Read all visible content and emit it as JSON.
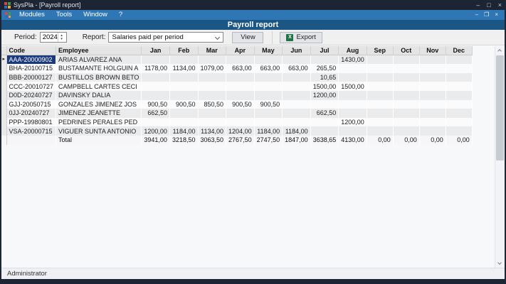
{
  "window": {
    "title": "SysPla - [Payroll report]",
    "controls": {
      "minimize": "–",
      "maximize": "□",
      "close": "×"
    }
  },
  "menu": {
    "items": [
      "Modules",
      "Tools",
      "Window",
      "?"
    ],
    "child_controls": {
      "minimize": "–",
      "restore": "❐",
      "close": "×"
    }
  },
  "header": {
    "title": "Payroll report"
  },
  "toolbar": {
    "period_label": "Period:",
    "period_value": "2024",
    "report_label": "Report:",
    "report_value": "Salaries paid per period",
    "view_label": "View",
    "export_label": "Export",
    "export_icon": "excel-icon",
    "export_icon_letter": "X"
  },
  "grid": {
    "columns": [
      "Code",
      "Employee",
      "Jan",
      "Feb",
      "Mar",
      "Apr",
      "May",
      "Jun",
      "Jul",
      "Aug",
      "Sep",
      "Oct",
      "Nov",
      "Dec"
    ],
    "rows": [
      {
        "code": "AAA-20000902",
        "employee": "ARIAS ALVAREZ ANA",
        "selected": true,
        "values": [
          "",
          "",
          "",
          "",
          "",
          "",
          "",
          "1430,00",
          "",
          "",
          "",
          ""
        ]
      },
      {
        "code": "BHA-20100715",
        "employee": "BUSTAMANTE HOLGUIN A",
        "values": [
          "1178,00",
          "1134,00",
          "1079,00",
          "663,00",
          "663,00",
          "663,00",
          "265,50",
          "",
          "",
          "",
          "",
          ""
        ]
      },
      {
        "code": "BBB-20000127",
        "employee": "BUSTILLOS BROWN BETO",
        "values": [
          "",
          "",
          "",
          "",
          "",
          "",
          "10,65",
          "",
          "",
          "",
          "",
          ""
        ]
      },
      {
        "code": "CCC-20010727",
        "employee": "CAMPBELL CARTES CECI",
        "values": [
          "",
          "",
          "",
          "",
          "",
          "",
          "1500,00",
          "1500,00",
          "",
          "",
          "",
          ""
        ]
      },
      {
        "code": "D0D-20240727",
        "employee": "DAVINSKY  DALIA",
        "values": [
          "",
          "",
          "",
          "",
          "",
          "",
          "1200,00",
          "",
          "",
          "",
          "",
          ""
        ]
      },
      {
        "code": "GJJ-20050715",
        "employee": "GONZALES JIMENEZ JOS",
        "values": [
          "900,50",
          "900,50",
          "850,50",
          "900,50",
          "900,50",
          "",
          "",
          "",
          "",
          "",
          "",
          ""
        ]
      },
      {
        "code": "0JJ-20240727",
        "employee": "JIMENEZ JEANETTE",
        "values": [
          "662,50",
          "",
          "",
          "",
          "",
          "",
          "662,50",
          "",
          "",
          "",
          "",
          ""
        ]
      },
      {
        "code": "PPP-19980801",
        "employee": "PEDRINES PERALES PED",
        "values": [
          "",
          "",
          "",
          "",
          "",
          "",
          "",
          "1200,00",
          "",
          "",
          "",
          ""
        ]
      },
      {
        "code": "VSA-20000715",
        "employee": "VIGUER SUNTA ANTONIO",
        "values": [
          "1200,00",
          "1184,00",
          "1134,00",
          "1204,00",
          "1184,00",
          "1184,00",
          "",
          "",
          "",
          "",
          "",
          ""
        ]
      }
    ],
    "total": {
      "label": "Total",
      "values": [
        "3941,00",
        "3218,50",
        "3063,50",
        "2767,50",
        "2747,50",
        "1847,00",
        "3638,65",
        "4130,00",
        "0,00",
        "0,00",
        "0,00",
        "0,00"
      ]
    },
    "selection_color": "#1a3a7c",
    "selected_row_marker": "▸"
  },
  "statusbar": {
    "text": "Administrator"
  }
}
